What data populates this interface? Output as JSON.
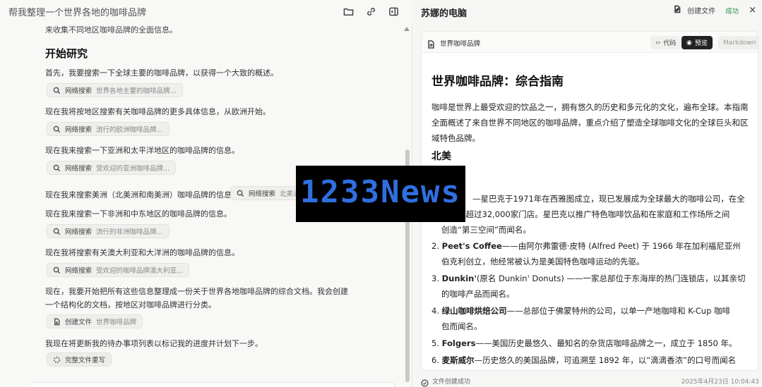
{
  "left": {
    "title": "帮我整理一个世界各地的咖啡品牌",
    "icons": [
      "folder-icon",
      "link-icon",
      "sidebar-toggle-icon"
    ]
  },
  "chat": {
    "intro_cut": "来收集不同地区咖啡品牌的全面信息。",
    "heading": "开始研究",
    "step1": "首先，我要搜索一下全球主要的咖啡品牌，以获得一个大致的概述。",
    "chip1": {
      "label": "网络搜索",
      "query": "世界各地主要的咖啡品牌..."
    },
    "step2": "现在我将按地区搜索有关咖啡品牌的更多具体信息，从欧洲开始。",
    "chip2": {
      "label": "网络搜索",
      "query": "流行的欧洲咖啡品牌..."
    },
    "step3": "现在我来搜索一下亚洲和太平洋地区的咖啡品牌的信息。",
    "chip3": {
      "label": "网络搜索",
      "query": "受欢迎的亚洲咖啡品牌..."
    },
    "step4": "现在我来搜索美洲（北美洲和南美洲）咖啡品牌的信息。",
    "chip4": {
      "label": "网络搜索",
      "query": "北美洲"
    },
    "step5": "现在我来搜索一下非洲和中东地区的咖啡品牌的信息。",
    "chip5": {
      "label": "网络搜索",
      "query": "流行的非洲咖啡品牌..."
    },
    "step6": "现在我将搜索有关澳大利亚和大洋洲的咖啡品牌的信息。",
    "chip6": {
      "label": "网络搜索",
      "query": "受欢迎的咖啡品牌澳大利亚..."
    },
    "step7a": "现在，我要开始把所有这些信息整理成一份关于世界各地咖啡品牌的综合文档。我会创建",
    "step7b": "一个结构化的文档，按地区对咖啡品牌进行分类。",
    "chip7": {
      "label": "创建文件",
      "query": "世界咖啡品牌"
    },
    "step8": "我现在将更新我的待办事项列表以标记我的进度并计划下一步。",
    "chip8": {
      "label": "完整文件重写"
    }
  },
  "right": {
    "title": "苏娜的电脑",
    "action": "创建文件",
    "status_badge": "成功",
    "close": "×"
  },
  "doc": {
    "filename": "世界咖啡品牌",
    "tab_code": "代码",
    "tab_preview": "预览",
    "tab_markdown": "Markdown",
    "h1": "世界咖啡品牌：综合指南",
    "intro": "咖啡是世界上最受欢迎的饮品之一，拥有悠久的历史和多元化的文化，遍布全球。本指南全面概述了来自世界不同地区的咖啡品牌，重点介绍了塑造全球咖啡文化的全球巨头和区域特色品牌。",
    "h_north_america": "北美",
    "item1_rest": "—星巴克于1971年在西雅图成立，现已发展成为全球最大的咖啡公司，在全",
    "item1_line2": "球拥有超过32,000家门店。星巴克以推广特色咖啡饮品和在家庭和工作场所之间",
    "item1_line3": "创造“第三空间”而闻名。",
    "item2_num": "2.",
    "item2_name": "Peet's Coffee",
    "item2_rest": "——由阿尔弗雷德·皮特 (Alfred Peet) 于 1966 年在加利福尼亚州",
    "item2_line2": "伯克利创立，他经常被认为是美国特色咖啡运动的先驱。",
    "item3_num": "3.",
    "item3_name": "Dunkin'",
    "item3_rest": "(原名 Dunkin' Donuts) ——一家总部位于东海岸的热门连锁店，以其亲切",
    "item3_line2": "的咖啡产品而闻名。",
    "item4_num": "4.",
    "item4_name": "绿山咖啡烘焙公司",
    "item4_rest": "——总部位于佛蒙特州的公司，以单一产地咖啡和 K-Cup 咖啡",
    "item4_line2": "包而闻名。",
    "item5_num": "5.",
    "item5_name": "Folgers",
    "item5_rest": "——美国历史最悠久、最知名的杂货店咖啡品牌之一，成立于 1850 年。",
    "item6_num": "6.",
    "item6_name": "麦斯威尔",
    "item6_rest": "—历史悠久的美国品牌，可追溯至 1892 年，以“滴滴香浓”的口号而闻名"
  },
  "status": {
    "text": "文件创建成功",
    "timestamp": "2025年4月23日 10:04:43"
  },
  "watermark": {
    "text": "1233News"
  }
}
